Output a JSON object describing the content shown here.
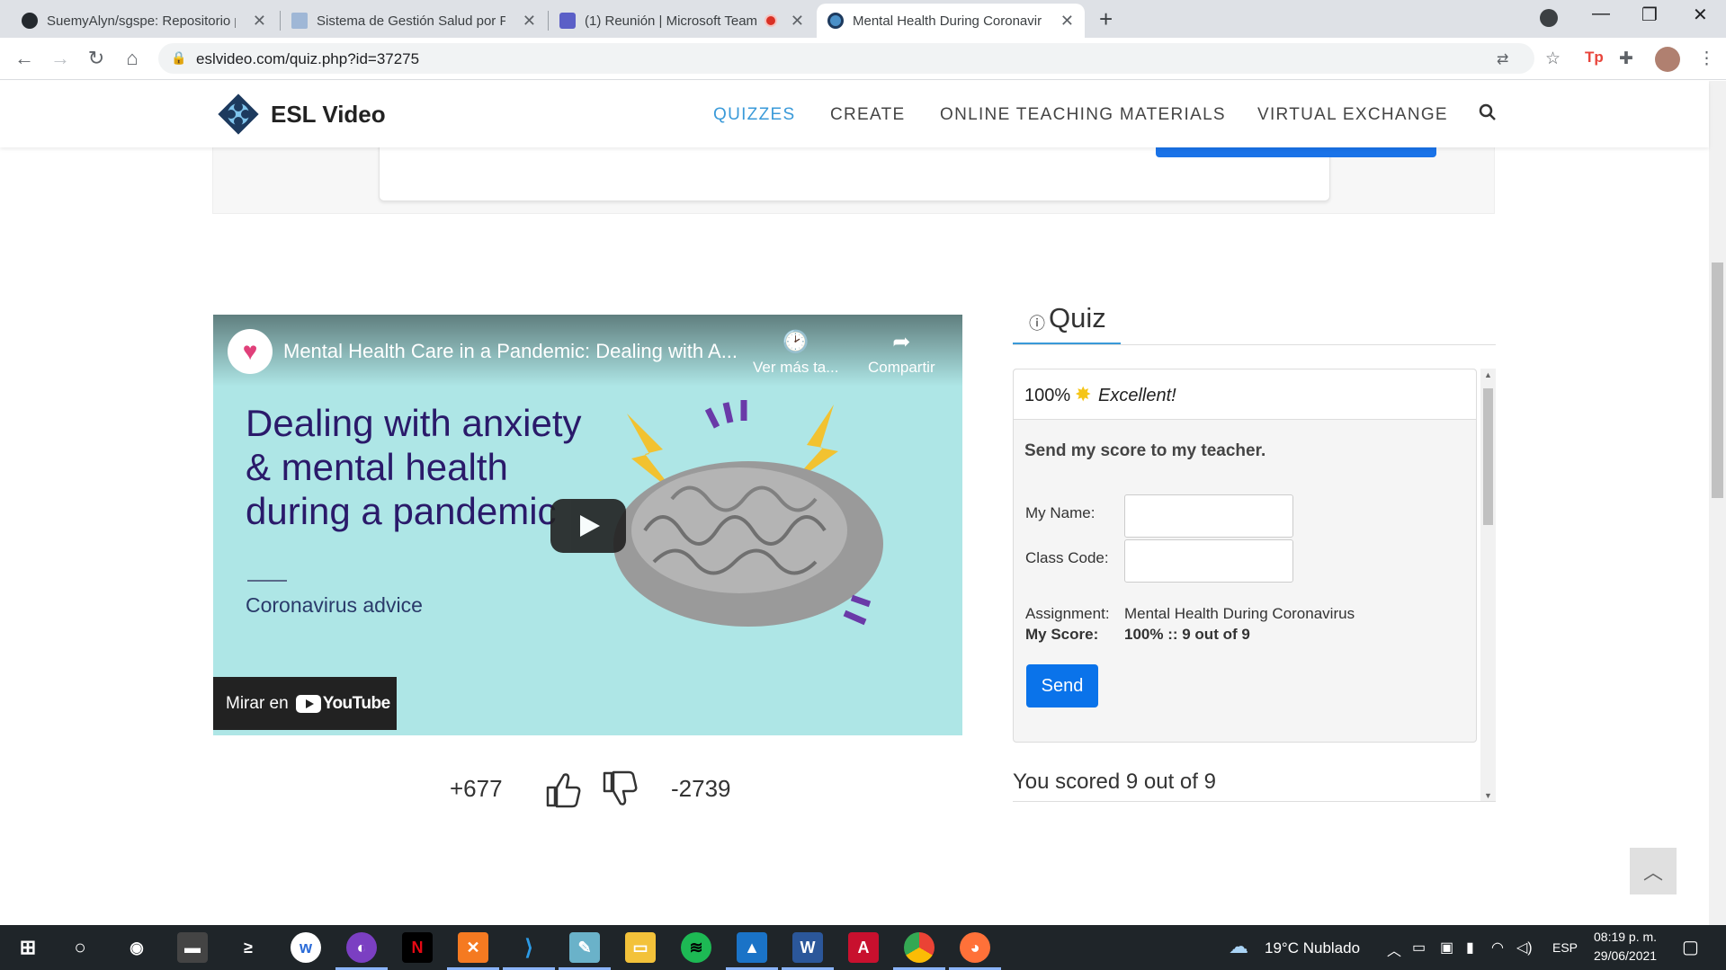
{
  "browser": {
    "tabs": [
      {
        "title": "SuemyAlyn/sgspe: Repositorio p",
        "icon": "github-icon",
        "active": false
      },
      {
        "title": "Sistema de Gestión Salud por Par",
        "icon": "doc-icon",
        "active": false
      },
      {
        "title": "(1) Reunión | Microsoft Team",
        "icon": "teams-icon",
        "active": false
      },
      {
        "title": "Mental Health During Coronaviru",
        "icon": "eslvideo-icon",
        "active": true
      }
    ],
    "new_tab": "+",
    "url": "eslvideo.com/quiz.php?id=37275"
  },
  "site": {
    "logo_text": "ESL Video",
    "nav": [
      {
        "label": "QUIZZES",
        "active": true
      },
      {
        "label": "CREATE",
        "active": false
      },
      {
        "label": "ONLINE TEACHING MATERIALS",
        "active": false
      },
      {
        "label": "VIRTUAL EXCHANGE",
        "active": false
      }
    ],
    "accent_color": "#3a9ad9"
  },
  "video": {
    "title": "Mental Health Care in a Pandemic: Dealing with A...",
    "watch_later": "Ver más ta...",
    "share": "Compartir",
    "headline_lines": [
      "Dealing with anxiety",
      "& mental health",
      "during a pandemic"
    ],
    "subtitle": "Coronavirus advice",
    "watch_on": "Mirar en",
    "youtube": "YouTube"
  },
  "votes": {
    "up": "+677",
    "down": "-2739"
  },
  "quiz": {
    "tab_label": "Quiz",
    "result_percent": "100%",
    "result_word": "Excellent!",
    "send_heading": "Send my score to my teacher.",
    "name_label": "My Name:",
    "class_label": "Class Code:",
    "assignment_label": "Assignment:",
    "assignment_value": "Mental Health During Coronavirus",
    "score_label": "My Score:",
    "score_value": "100% :: 9 out of 9",
    "send_button": "Send",
    "scored_text": "You scored 9 out of 9"
  },
  "taskbar": {
    "weather": "19°C  Nublado",
    "lang": "ESP",
    "time": "08:19 p. m.",
    "date": "29/06/2021"
  }
}
